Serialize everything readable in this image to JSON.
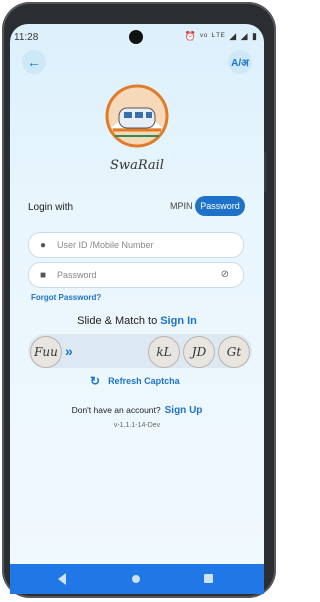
{
  "status": {
    "time": "11:28",
    "icons": "⏰ ᵛᵒ ᴸᵀᴱ ◢ ◢ ▮"
  },
  "header": {
    "back_icon": "arrow-left-icon",
    "lang_label": "A/अ"
  },
  "brand": {
    "name": "SwaRail"
  },
  "login": {
    "title": "Login with",
    "tab_mpin": "MPIN",
    "tab_password": "Password",
    "user_placeholder": "User ID /Mobile Number",
    "password_placeholder": "Password",
    "forgot": "Forgot Password?"
  },
  "captcha": {
    "prompt": "Slide & Match to",
    "signin": "Sign In",
    "arrows": "»",
    "slider_text": "Fuu",
    "options": [
      "kL",
      "JD",
      "Gt"
    ],
    "refresh": "Refresh Captcha"
  },
  "footer": {
    "account_text": "Don't have an account?",
    "signup": "Sign Up",
    "version": "v-1.1.1-14-Dev"
  },
  "colors": {
    "accent": "#1e73c8",
    "navbar": "#1f78e6"
  }
}
